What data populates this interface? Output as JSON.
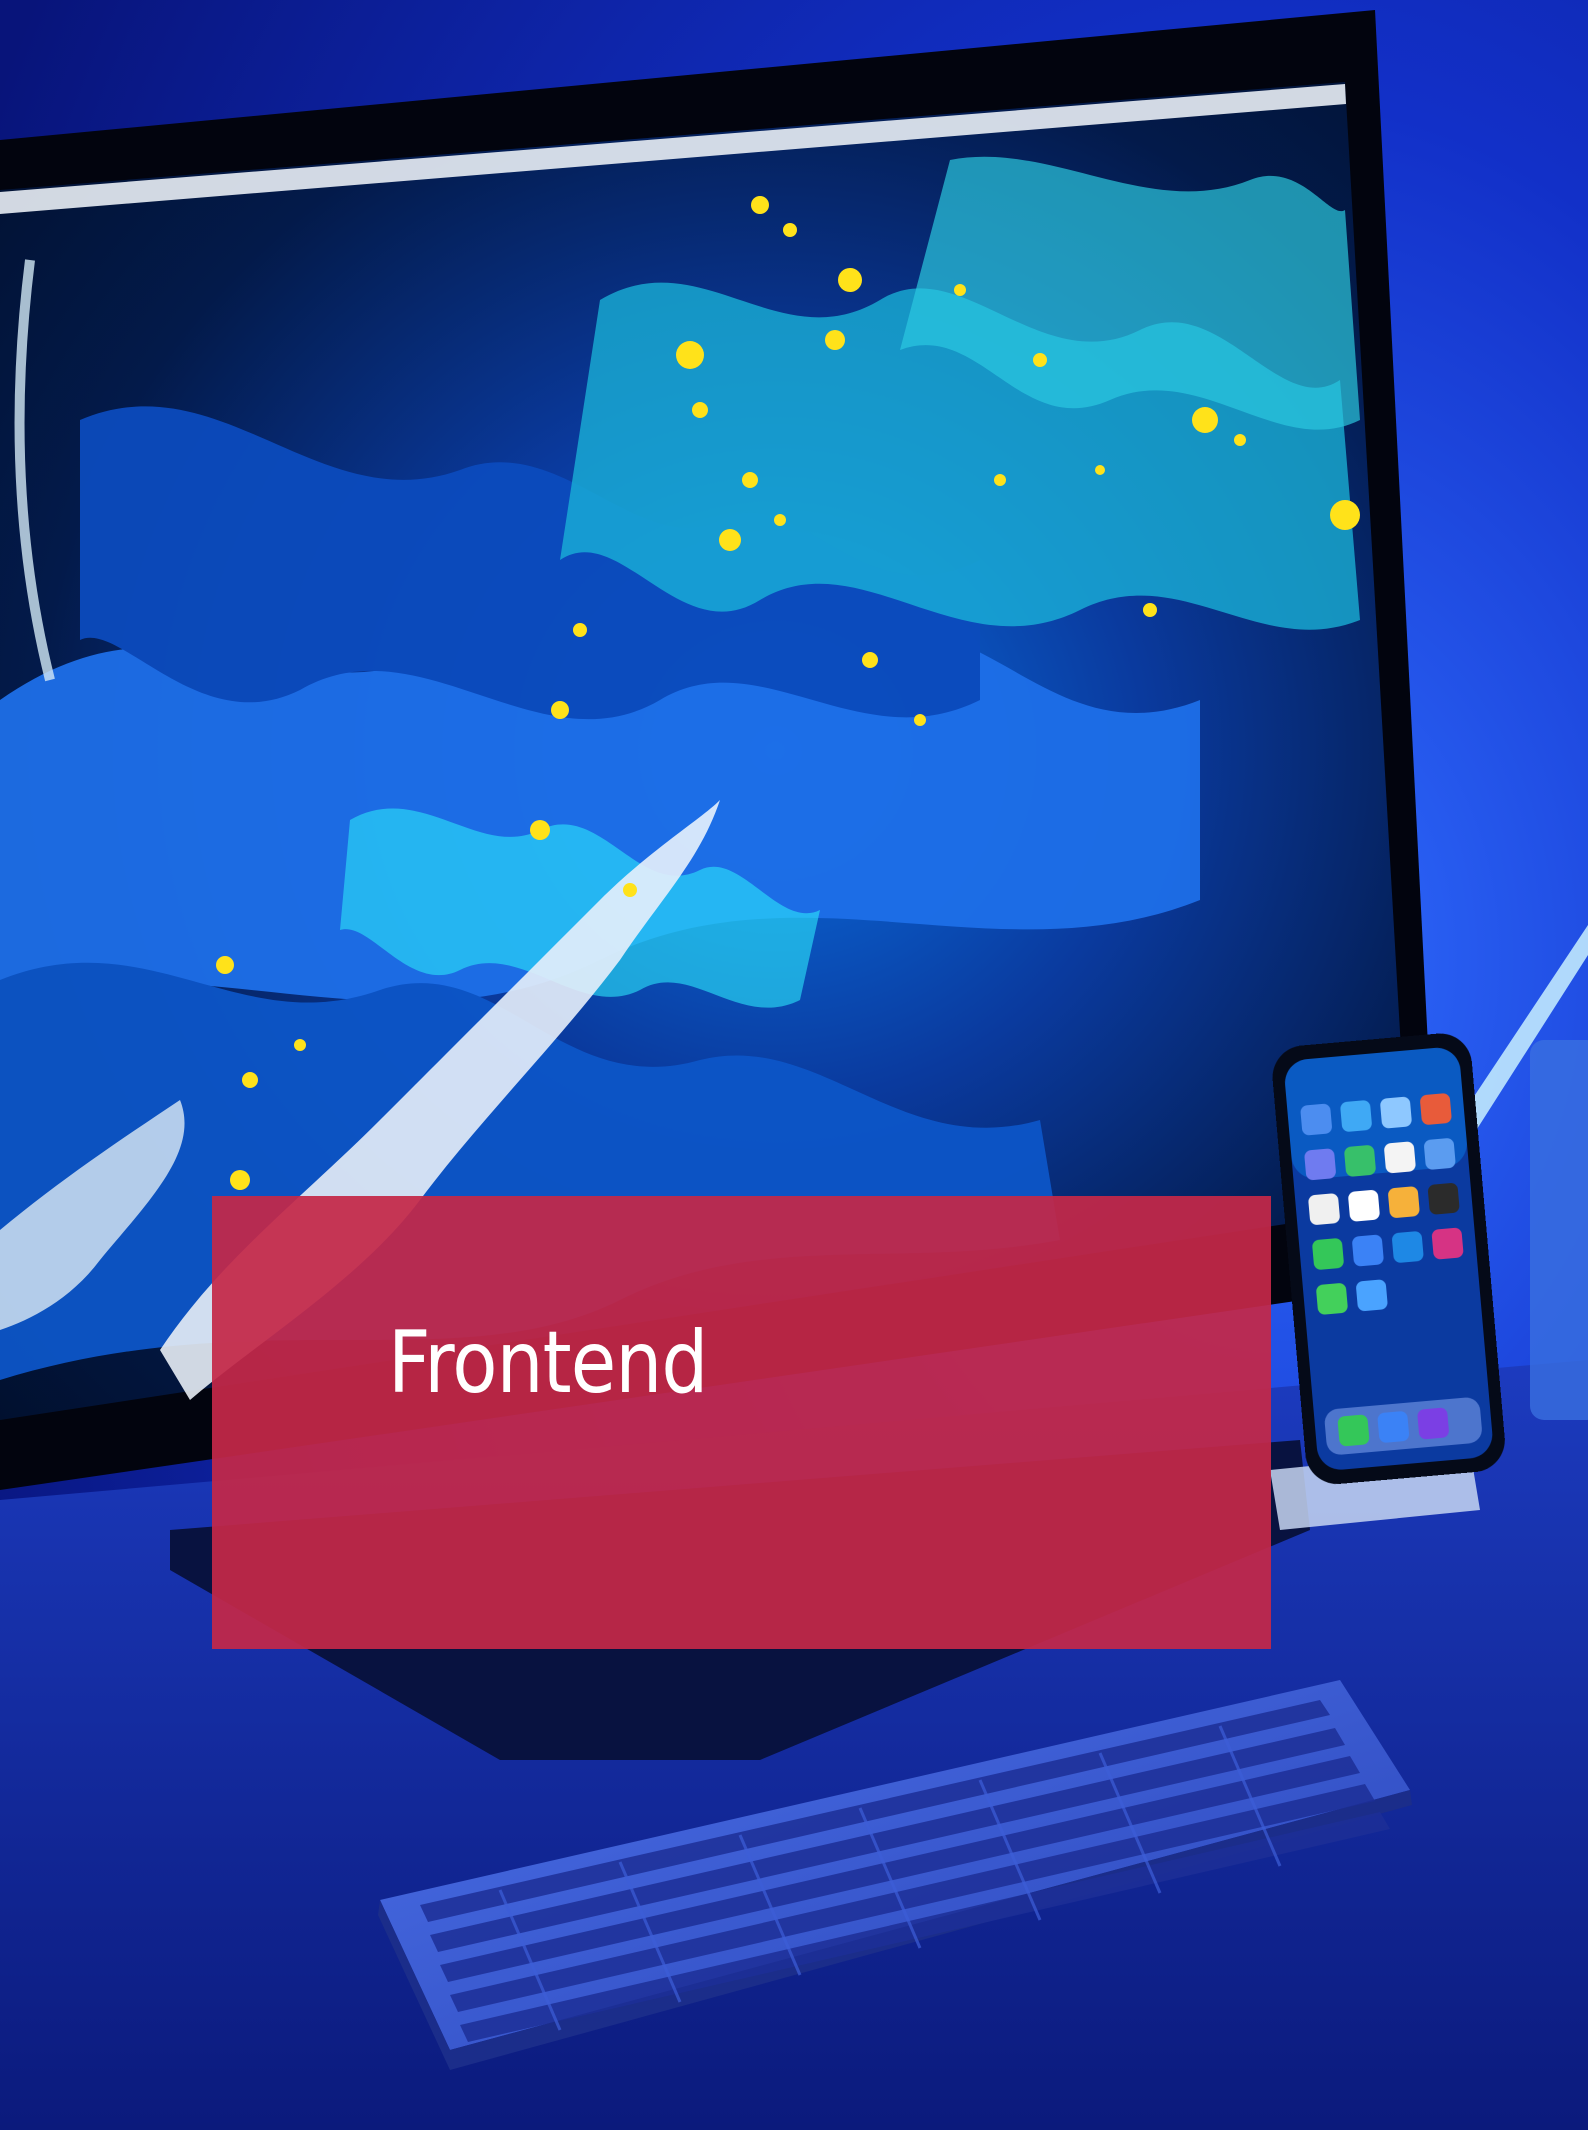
{
  "card": {
    "title": "Frontend",
    "color": "#c42848"
  },
  "photo": {
    "background_color": "#0a1a8f",
    "screen_palette": [
      "#041a4a",
      "#0a5fd6",
      "#27c6e6",
      "#ffe21a",
      "#ffffff"
    ]
  }
}
